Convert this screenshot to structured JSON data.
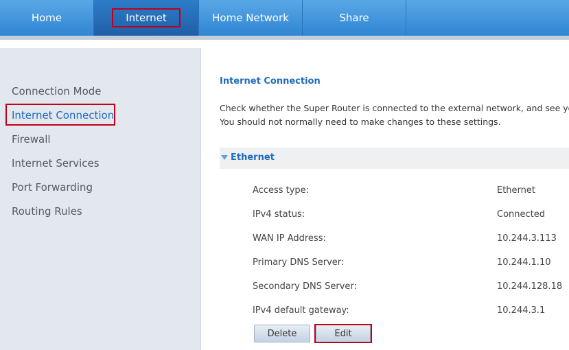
{
  "topnav": {
    "tabs": [
      {
        "label": "Home"
      },
      {
        "label": "Internet"
      },
      {
        "label": "Home Network"
      },
      {
        "label": "Share"
      }
    ]
  },
  "sidebar": {
    "items": [
      {
        "label": "Connection Mode"
      },
      {
        "label": "Internet Connection"
      },
      {
        "label": "Firewall"
      },
      {
        "label": "Internet Services"
      },
      {
        "label": "Port Forwarding"
      },
      {
        "label": "Routing Rules"
      }
    ]
  },
  "main": {
    "title": "Internet Connection",
    "description_line1": "Check whether the Super Router is connected to the external network, and see your co",
    "description_line2": "You should not normally need to make changes to these settings.",
    "section": "Ethernet",
    "rows": [
      {
        "label": "Access type:",
        "value": "Ethernet"
      },
      {
        "label": "IPv4 status:",
        "value": "Connected"
      },
      {
        "label": "WAN IP Address:",
        "value": "10.244.3.113"
      },
      {
        "label": "Primary DNS Server:",
        "value": "10.244.1.10"
      },
      {
        "label": "Secondary DNS Server:",
        "value": "10.244.128.18"
      },
      {
        "label": "IPv4 default gateway:",
        "value": "10.244.3.1"
      }
    ],
    "delete_label": "Delete",
    "edit_label": "Edit"
  },
  "colors": {
    "accent": "#1d6bbf",
    "nav": "#2f86d3",
    "highlight": "#c0001a"
  }
}
